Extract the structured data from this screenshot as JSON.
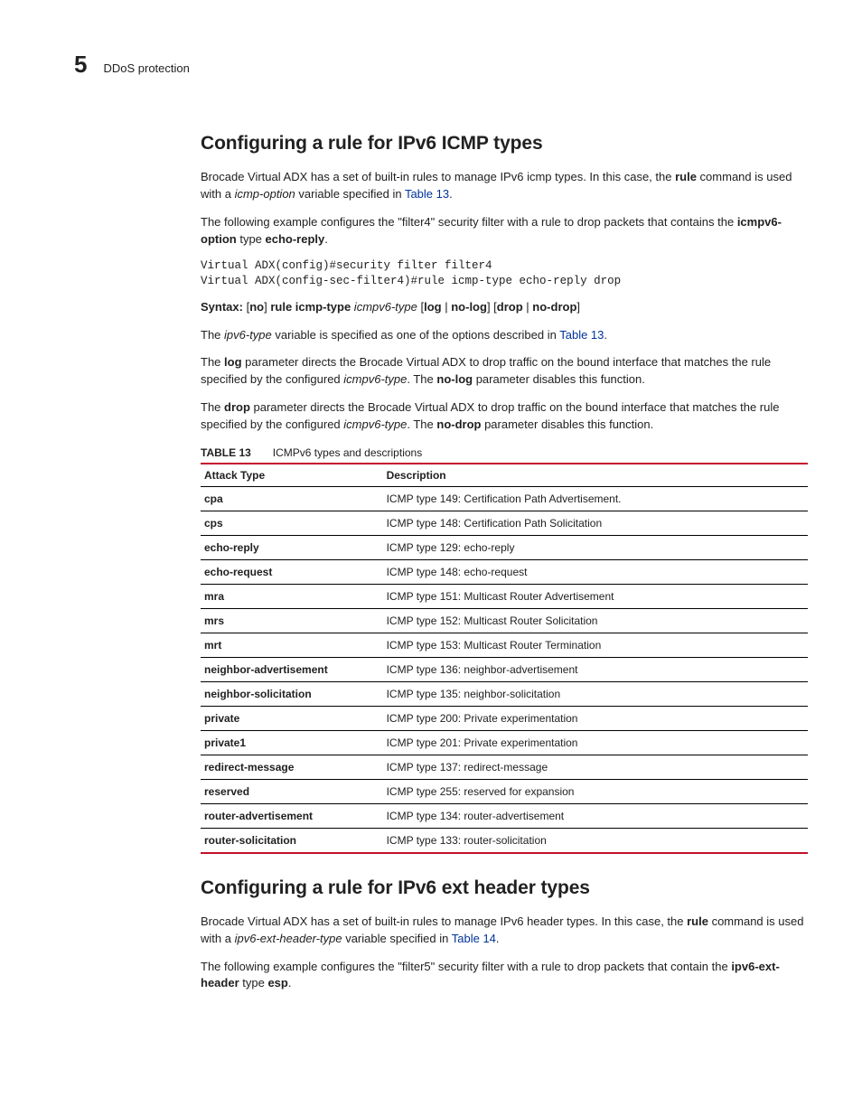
{
  "header": {
    "chapter_number": "5",
    "section_label": "DDoS protection"
  },
  "sec1": {
    "heading": "Configuring a rule for IPv6 ICMP types",
    "p1_a": "Brocade Virtual ADX has a set of built-in rules to manage IPv6 icmp types. In this case, the ",
    "p1_b": "rule",
    "p1_c": " command is used with a ",
    "p1_d": "icmp-option",
    "p1_e": " variable specified in ",
    "p1_link": "Table 13",
    "p1_f": ".",
    "p2_a": "The following example configures the \"filter4\" security filter with a rule to drop packets that contains the ",
    "p2_b": "icmpv6-option",
    "p2_c": " type ",
    "p2_d": "echo-reply",
    "p2_e": ".",
    "code": "Virtual ADX(config)#security filter filter4\nVirtual ADX(config-sec-filter4)#rule icmp-type echo-reply drop",
    "syntax_label": "Syntax:  ",
    "syntax_a": "[",
    "syntax_b": "no",
    "syntax_c": "] ",
    "syntax_d": "rule icmp-type",
    "syntax_e": " icmpv6-type ",
    "syntax_f": "[",
    "syntax_g": "log",
    "syntax_h": " | ",
    "syntax_i": "no-log",
    "syntax_j": "] [",
    "syntax_k": "drop",
    "syntax_l": " | ",
    "syntax_m": "no-drop",
    "syntax_n": "]",
    "p3_a": "The ",
    "p3_b": "ipv6-type",
    "p3_c": " variable is specified as one of the options described in ",
    "p3_link": "Table 13",
    "p3_d": ".",
    "p4_a": "The ",
    "p4_b": "log",
    "p4_c": " parameter directs the Brocade Virtual ADX to drop traffic on the bound interface that matches the rule specified by the configured ",
    "p4_d": "icmpv6-type",
    "p4_e": ". The ",
    "p4_f": "no-log",
    "p4_g": " parameter disables this function.",
    "p5_a": "The ",
    "p5_b": "drop",
    "p5_c": " parameter directs the Brocade Virtual ADX to drop traffic on the bound interface that matches the rule specified by the configured ",
    "p5_d": "icmpv6-type",
    "p5_e": ". The ",
    "p5_f": "no-drop",
    "p5_g": " parameter disables this function."
  },
  "table13": {
    "label": "TABLE 13",
    "caption": "ICMPv6 types and descriptions",
    "head_attack": "Attack Type",
    "head_desc": "Description",
    "rows": [
      {
        "attack": "cpa",
        "desc": "ICMP type 149: Certification Path Advertisement."
      },
      {
        "attack": "cps",
        "desc": "ICMP type 148: Certification Path Solicitation"
      },
      {
        "attack": "echo-reply",
        "desc": "ICMP type 129: echo-reply"
      },
      {
        "attack": "echo-request",
        "desc": "ICMP type 148: echo-request"
      },
      {
        "attack": "mra",
        "desc": "ICMP type 151: Multicast Router Advertisement"
      },
      {
        "attack": "mrs",
        "desc": "ICMP type 152: Multicast Router Solicitation"
      },
      {
        "attack": "mrt",
        "desc": "ICMP type 153: Multicast Router Termination"
      },
      {
        "attack": "neighbor-advertisement",
        "desc": "ICMP type 136: neighbor-advertisement"
      },
      {
        "attack": "neighbor-solicitation",
        "desc": "ICMP type 135: neighbor-solicitation"
      },
      {
        "attack": "private",
        "desc": "ICMP type 200: Private experimentation"
      },
      {
        "attack": "private1",
        "desc": "ICMP type 201: Private experimentation"
      },
      {
        "attack": "redirect-message",
        "desc": "ICMP type 137: redirect-message"
      },
      {
        "attack": "reserved",
        "desc": "ICMP type 255: reserved for expansion"
      },
      {
        "attack": "router-advertisement",
        "desc": "ICMP type 134: router-advertisement"
      },
      {
        "attack": "router-solicitation",
        "desc": "ICMP type 133: router-solicitation"
      }
    ]
  },
  "sec2": {
    "heading": "Configuring a rule for IPv6 ext header types",
    "p1_a": "Brocade Virtual ADX has a set of built-in rules to manage IPv6 header types. In this case, the ",
    "p1_b": "rule",
    "p1_c": " command is used with a ",
    "p1_d": "ipv6-ext-header-type",
    "p1_e": " variable specified in ",
    "p1_link": "Table 14",
    "p1_f": ".",
    "p2_a": "The following example configures the \"filter5\" security filter with a rule to drop packets that contain the ",
    "p2_b": "ipv6-ext-header",
    "p2_c": " type ",
    "p2_d": "esp",
    "p2_e": "."
  }
}
